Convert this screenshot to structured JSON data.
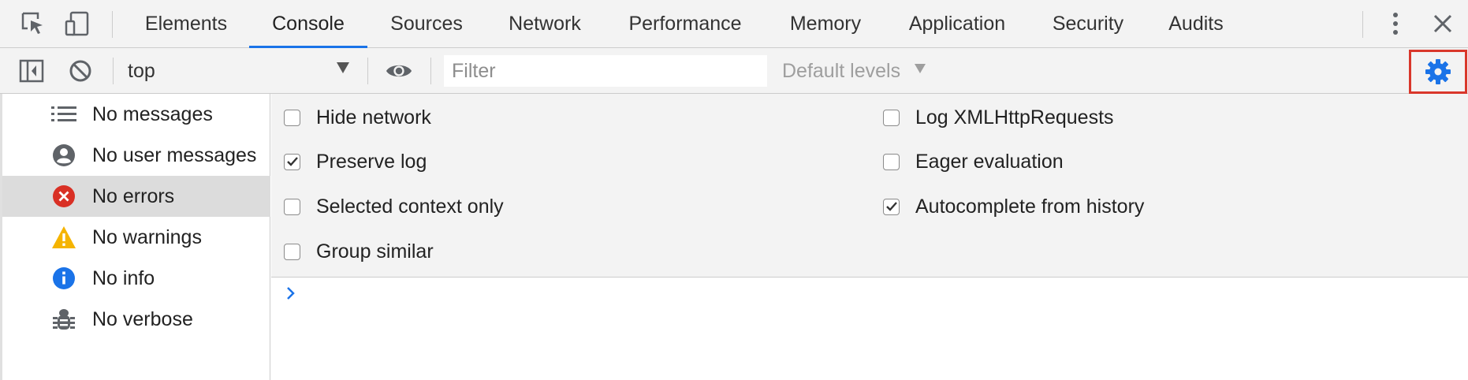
{
  "tabs": [
    {
      "label": "Elements"
    },
    {
      "label": "Console"
    },
    {
      "label": "Sources"
    },
    {
      "label": "Network"
    },
    {
      "label": "Performance"
    },
    {
      "label": "Memory"
    },
    {
      "label": "Application"
    },
    {
      "label": "Security"
    },
    {
      "label": "Audits"
    }
  ],
  "active_tab": "Console",
  "toolbar": {
    "context": "top",
    "filter_placeholder": "Filter",
    "levels": "Default levels"
  },
  "sidebar": {
    "items": [
      {
        "label": "No messages",
        "icon": "list-icon"
      },
      {
        "label": "No user messages",
        "icon": "user-icon"
      },
      {
        "label": "No errors",
        "icon": "error-icon"
      },
      {
        "label": "No warnings",
        "icon": "warning-icon"
      },
      {
        "label": "No info",
        "icon": "info-icon"
      },
      {
        "label": "No verbose",
        "icon": "bug-icon"
      }
    ],
    "selected": "No errors"
  },
  "settings": {
    "left": [
      {
        "label": "Hide network",
        "checked": false
      },
      {
        "label": "Preserve log",
        "checked": true
      },
      {
        "label": "Selected context only",
        "checked": false
      },
      {
        "label": "Group similar",
        "checked": false
      }
    ],
    "right": [
      {
        "label": "Log XMLHttpRequests",
        "checked": false
      },
      {
        "label": "Eager evaluation",
        "checked": false
      },
      {
        "label": "Autocomplete from history",
        "checked": true
      }
    ]
  },
  "colors": {
    "accent": "#1a73e8",
    "highlight_box": "#d9372b",
    "error": "#d93025",
    "warning": "#f5b400",
    "info": "#1a73e8"
  }
}
